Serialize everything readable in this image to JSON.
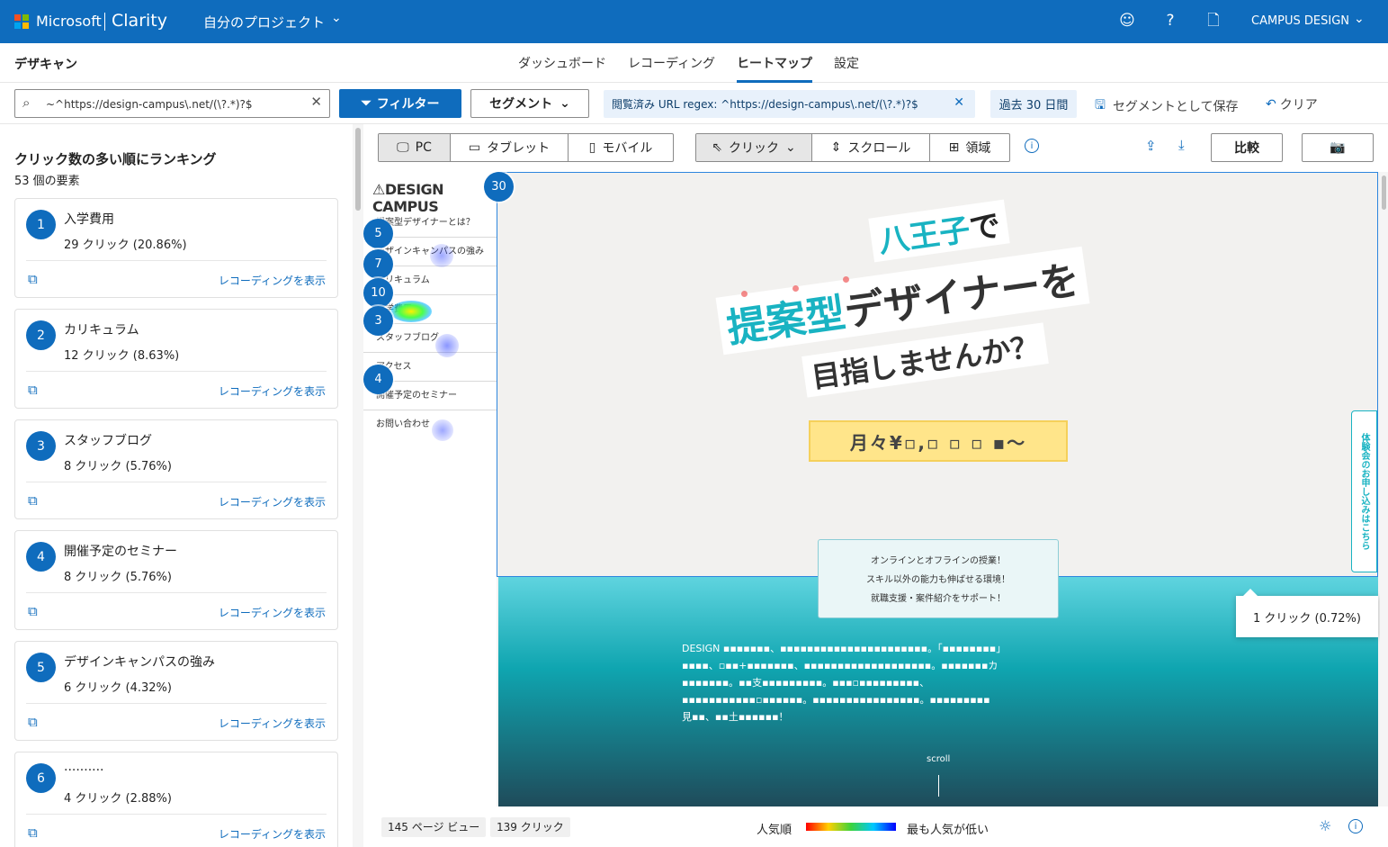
{
  "topbar": {
    "brand_ms": "Microsoft",
    "brand_product": "Clarity",
    "project": "自分のプロジェクト",
    "account": "CAMPUS DESIGN",
    "icons": [
      "smiley-icon",
      "help-icon",
      "document-icon",
      "chevron-down-icon"
    ],
    "color": "#0f6cbd"
  },
  "nav": {
    "site_name": "デザキャン",
    "tabs": [
      "ダッシュボード",
      "レコーディング",
      "ヒートマップ",
      "設定"
    ],
    "active_tab": "ヒートマップ"
  },
  "filters": {
    "search_value": "~^https://design-campus\\.net/(\\?.*)?$",
    "filter_label": "フィルター",
    "segment_label": "セグメント",
    "url_chip": "閲覧済み URL regex: ^https://design-campus\\.net/(\\?.*)?$",
    "date_chip": "過去 30 日間",
    "save_segment": "セグメントとして保存",
    "clear": "クリア"
  },
  "left_panel": {
    "title": "クリック数の多い順にランキング",
    "subtitle": "53 個の要素",
    "recording_link": "レコーディングを表示",
    "items": [
      {
        "rank": "1",
        "name": "入学費用",
        "clicks": "29 クリック (20.86%)"
      },
      {
        "rank": "2",
        "name": "カリキュラム",
        "clicks": "12 クリック (8.63%)"
      },
      {
        "rank": "3",
        "name": "スタッフブログ",
        "clicks": "8 クリック (5.76%)"
      },
      {
        "rank": "4",
        "name": "開催予定のセミナー",
        "clicks": "8 クリック (5.76%)"
      },
      {
        "rank": "5",
        "name": "デザインキャンパスの強み",
        "clicks": "6 クリック (4.32%)"
      },
      {
        "rank": "6",
        "name": "··········",
        "clicks": "4 クリック (2.88%)"
      }
    ]
  },
  "toolbar": {
    "devices": [
      "PC",
      "タブレット",
      "モバイル"
    ],
    "active_device": "PC",
    "modes": [
      "クリック",
      "スクロール",
      "領域"
    ],
    "active_mode": "クリック",
    "compare": "比較"
  },
  "preview": {
    "logo": "⚠DESIGN CAMPUS",
    "nav_items": [
      "提案型デザイナーとは？",
      "デザインキャンパスの強み",
      "カリキュラム",
      "入学費用",
      "スタッフブログ",
      "アクセス",
      "開催予定のセミナー",
      "お問い合わせ"
    ],
    "hero_line1_teal": "八王子",
    "hero_line1_rest": "で",
    "hero_line2_teal": "提案型",
    "hero_line2_rest": "デザイナーを",
    "hero_line3": "目指しませんか？",
    "price": "月々¥▫,▫ ▫ ▫ ▪〜",
    "features": [
      "オンラインとオフラインの授業！",
      "スキル以外の能力も伸ばせる環境！",
      "就職支援・案件紹介をサポート！"
    ],
    "body_lines": [
      "DESIGN ▪▪▪▪▪▪▪、▪▪▪▪▪▪▪▪▪▪▪▪▪▪▪▪▪▪▪▪▪▪。「▪▪▪▪▪▪▪▪」",
      "▪▪▪▪、▫▪▪+▪▪▪▪▪▪▪、▪▪▪▪▪▪▪▪▪▪▪▪▪▪▪▪▪▪▪。▪▪▪▪▪▪▪カ",
      "▪▪▪▪▪▪▪。▪▪支▪▪▪▪▪▪▪▪▪。▪▪▪▫▪▪▪▪▪▪▪▪▪、",
      "▪▪▪▪▪▪▪▪▪▪▪▫▪▪▪▪▪▪。▪▪▪▪▪▪▪▪▪▪▪▪▪▪▪▪。▪▪▪▪▪▪▪▪▪",
      "見▪▪、▪▪土▪▪▪▪▪▪！"
    ],
    "scroll_label": "scroll",
    "side_tab": "体験会のお申し込みはこちら",
    "tooltip": "1 クリック (0.72%)",
    "badges": [
      "30",
      "5",
      "7",
      "10",
      "3",
      "4"
    ]
  },
  "bottom": {
    "page_views": "145 ページ ビュー",
    "clicks": "139 クリック",
    "legend_left": "人気順",
    "legend_right": "最も人気が低い"
  }
}
